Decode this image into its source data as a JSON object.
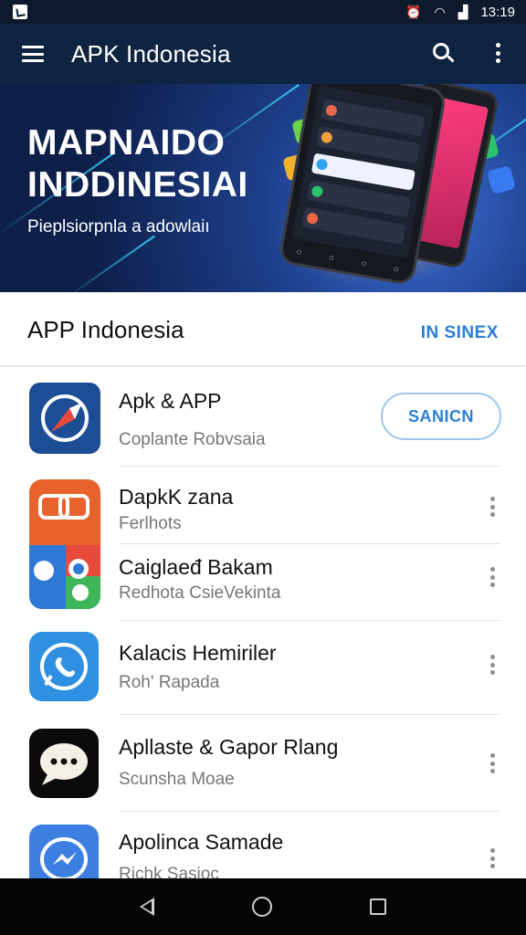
{
  "status_bar": {
    "time": "13:19"
  },
  "app_bar": {
    "title": "APK Indonesia"
  },
  "hero": {
    "title_line1": "MAPNAIDO",
    "title_line2": "INDDINESIAI",
    "subtitle": "Pieplsiorpnla a adowlaiı"
  },
  "section": {
    "title": "APP Indonesia",
    "action": "IN SINEX"
  },
  "apps": [
    {
      "name": "Apk & APP",
      "subtitle": "Coplante Robvsaia",
      "action": "SANICN",
      "icon": "compass-icon"
    },
    {
      "name": "DapkK zana",
      "subtitle": "Ferlhots",
      "icon": "chat-bubbles-icon"
    },
    {
      "name": "Caiglaeđ Bakam",
      "subtitle": "Redhota CsieVekinta",
      "icon": "multi-app-icon"
    },
    {
      "name": "Kalacis Hemiriler",
      "subtitle": "Roh' Rapada",
      "icon": "phone-chat-icon"
    },
    {
      "name": "Apllaste & Gapor Rlang",
      "subtitle": "Scunsha Moae",
      "icon": "speech-bubble-icon"
    },
    {
      "name": "Apolinca Samade",
      "subtitle": "Richk Sasioc",
      "icon": "messenger-icon"
    }
  ],
  "colors": {
    "appbar": "#0f2440",
    "accent": "#2a7fd4",
    "navbar": "#050505"
  }
}
